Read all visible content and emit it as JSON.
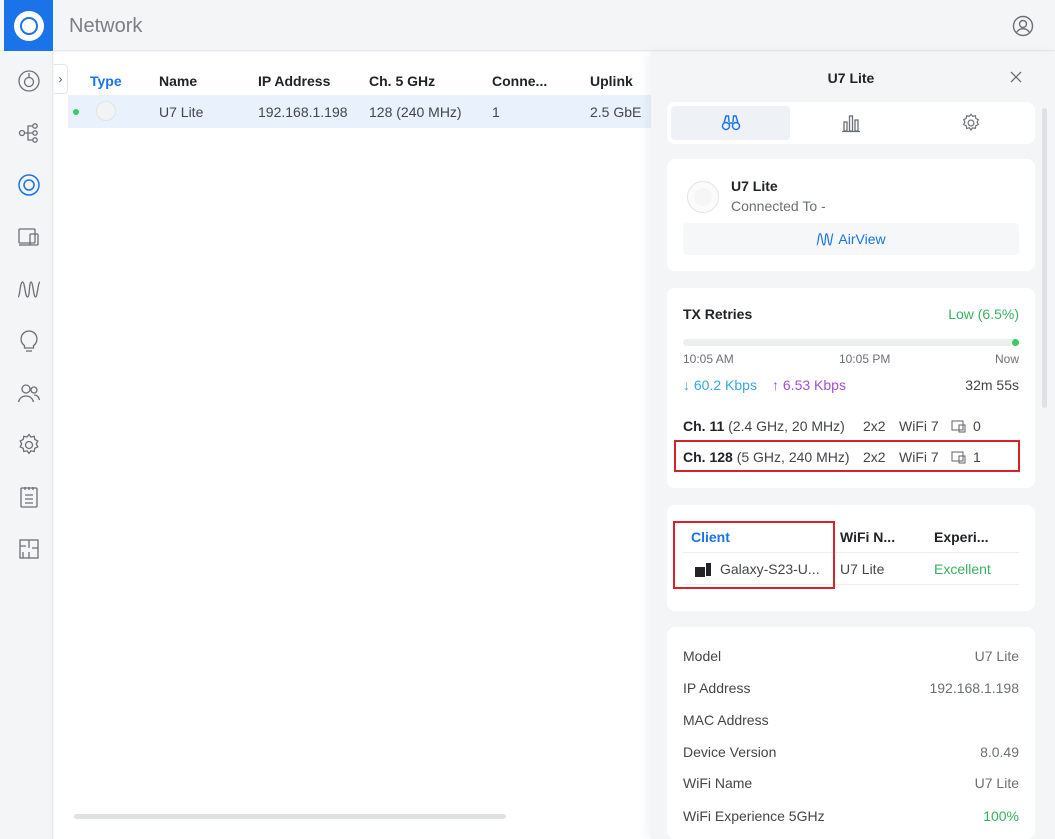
{
  "header": {
    "app_title": "Network",
    "logo_icon": "unifi-logo-icon",
    "user_icon": "user-circle-icon"
  },
  "nav": {
    "items": [
      {
        "name": "dashboard-icon"
      },
      {
        "name": "topology-icon"
      },
      {
        "name": "devices-icon",
        "active": true
      },
      {
        "name": "clients-icon"
      },
      {
        "name": "radio-icon"
      },
      {
        "name": "insights-icon"
      },
      {
        "name": "users-icon"
      },
      {
        "name": "settings-icon"
      },
      {
        "name": "logs-icon"
      },
      {
        "name": "floorplan-icon"
      }
    ]
  },
  "table": {
    "columns": [
      "Type",
      "Name",
      "IP Address",
      "Ch. 5 GHz",
      "Conne...",
      "Uplink"
    ],
    "rows": [
      {
        "name": "U7 Lite",
        "ip": "192.168.1.198",
        "channel": "128 (240 MHz)",
        "connections": "1",
        "uplink": "2.5 GbE"
      }
    ]
  },
  "panel": {
    "title": "U7 Lite",
    "tabs": [
      "overview-icon",
      "stats-icon",
      "settings-icon"
    ],
    "device": {
      "name": "U7 Lite",
      "connected_to": "Connected To -",
      "airview_label": "AirView"
    },
    "tx": {
      "label": "TX Retries",
      "status": "Low (6.5%)",
      "level_percent": 6.5,
      "ticks": [
        "10:05 AM",
        "10:05 PM",
        "Now"
      ],
      "down_rate": "↓ 60.2 Kbps",
      "up_rate": "↑ 6.53 Kbps",
      "uptime": "32m 55s"
    },
    "channels": [
      {
        "ch": "Ch. 11",
        "detail": "(2.4 GHz, 20 MHz)",
        "mimo": "2x2",
        "std": "WiFi 7",
        "clients": "0"
      },
      {
        "ch": "Ch. 128",
        "detail": "(5 GHz, 240 MHz)",
        "mimo": "2x2",
        "std": "WiFi 7",
        "clients": "1"
      }
    ],
    "clients": {
      "columns": [
        "Client",
        "WiFi N...",
        "Experi..."
      ],
      "rows": [
        {
          "client": "Galaxy-S23-U...",
          "wifi": "U7 Lite",
          "experience": "Excellent"
        }
      ]
    },
    "info": [
      {
        "k": "Model",
        "v": "U7 Lite"
      },
      {
        "k": "IP Address",
        "v": "192.168.1.198"
      },
      {
        "k": "MAC Address",
        "v": ""
      },
      {
        "k": "Device Version",
        "v": "8.0.49"
      },
      {
        "k": "WiFi Name",
        "v": "U7 Lite"
      },
      {
        "k": "WiFi Experience 5GHz",
        "v": "100%"
      }
    ]
  },
  "colors": {
    "accent": "#1a73e8",
    "good": "#38b25e",
    "download": "#36a7e0",
    "upload": "#a052d8",
    "highlight": "#d6232b"
  }
}
